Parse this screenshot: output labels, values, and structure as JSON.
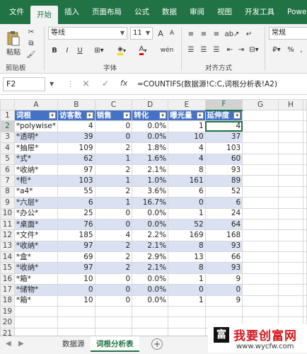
{
  "ribbon_tabs": [
    "文件",
    "开始",
    "插入",
    "页面布局",
    "公式",
    "数据",
    "审阅",
    "视图",
    "开发工具",
    "Powe"
  ],
  "active_tab_index": 1,
  "clipboard": {
    "paste_label": "粘贴",
    "group_label": "剪贴板"
  },
  "font": {
    "name": "等线",
    "size": "11",
    "group_label": "字体",
    "bold": "B",
    "italic": "I",
    "underline": "U",
    "grow": "A",
    "shrink": "A",
    "color_letter": "A",
    "phonetic": "wén"
  },
  "alignment": {
    "group_label": "对齐方式"
  },
  "number": {
    "format": "常规"
  },
  "formula_bar": {
    "name_box": "F2",
    "fx": "fx",
    "cancel": "×",
    "confirm": "✓",
    "formula": "=COUNTIFS(数据源!C:C,词根分析表!A2)"
  },
  "columns": [
    "A",
    "B",
    "C",
    "D",
    "E",
    "F",
    "G",
    "H"
  ],
  "table_headers": [
    "词根",
    "访客数",
    "销售",
    "转化",
    "曝光量",
    "延伸度"
  ],
  "rows": [
    [
      "*polywise*",
      "4",
      "0",
      "0.0%",
      "1",
      "4"
    ],
    [
      "*透明*",
      "39",
      "0",
      "0.0%",
      "10",
      "37"
    ],
    [
      "*抽屉*",
      "109",
      "2",
      "1.8%",
      "4",
      "103"
    ],
    [
      "*式*",
      "62",
      "1",
      "1.6%",
      "4",
      "60"
    ],
    [
      "*收纳*",
      "97",
      "2",
      "2.1%",
      "8",
      "93"
    ],
    [
      "*柜*",
      "103",
      "1",
      "1.0%",
      "161",
      "89"
    ],
    [
      "*a4*",
      "55",
      "2",
      "3.6%",
      "6",
      "52"
    ],
    [
      "*六层*",
      "6",
      "1",
      "16.7%",
      "0",
      "6"
    ],
    [
      "*办公*",
      "25",
      "0",
      "0.0%",
      "1",
      "24"
    ],
    [
      "*桌面*",
      "76",
      "0",
      "0.0%",
      "52",
      "64"
    ],
    [
      "*文件*",
      "185",
      "4",
      "2.2%",
      "169",
      "168"
    ],
    [
      "*收纳*",
      "97",
      "2",
      "2.1%",
      "8",
      "93"
    ],
    [
      "*盒*",
      "69",
      "2",
      "2.9%",
      "13",
      "66"
    ],
    [
      "*收纳*",
      "97",
      "2",
      "2.1%",
      "8",
      "93"
    ],
    [
      "*箱*",
      "10",
      "0",
      "0.0%",
      "1",
      "9"
    ],
    [
      "*储物*",
      "0",
      "0",
      "0.0%",
      "0",
      "0"
    ],
    [
      "*箱*",
      "10",
      "0",
      "0.0%",
      "1",
      "9"
    ]
  ],
  "row_numbers": [
    "1",
    "2",
    "3",
    "4",
    "5",
    "6",
    "7",
    "8",
    "9",
    "10",
    "11",
    "12",
    "13",
    "14",
    "15",
    "16",
    "17",
    "18",
    "19",
    "20",
    "21"
  ],
  "sheets": [
    "数据源",
    "词根分析表"
  ],
  "active_sheet_index": 1,
  "add_sheet": "+",
  "watermark": {
    "brand": "我要创富网",
    "url": "www.wycfw.com",
    "seal": "富"
  },
  "colors": {
    "excel_green": "#217346",
    "header_blue": "#4472c4",
    "band_blue": "#d9e1f2"
  }
}
